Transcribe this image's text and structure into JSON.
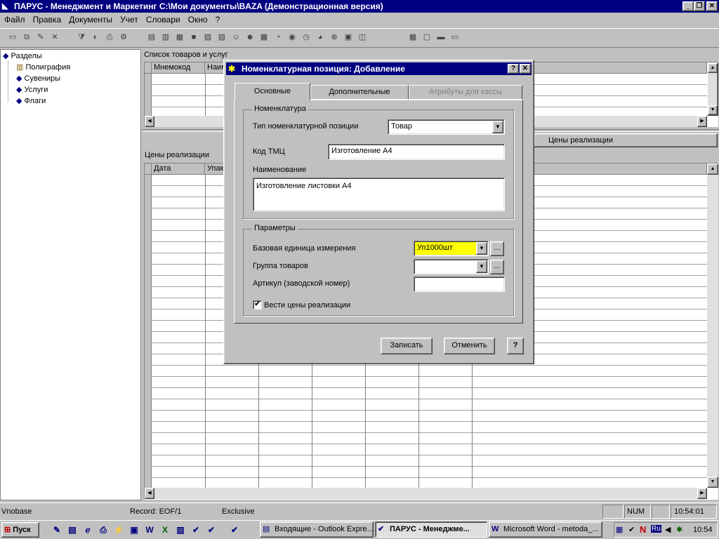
{
  "app": {
    "title": "ПАРУС - Менеджмент и Маркетинг  C:\\Мои документы\\BAZA (Демонстрационная версия)",
    "menu": [
      "Файл",
      "Правка",
      "Документы",
      "Учет",
      "Словари",
      "Окно",
      "?"
    ]
  },
  "tree": {
    "root": "Разделы",
    "items": [
      "Полиграфия",
      "Сувениры",
      "Услуги",
      "Флаги"
    ]
  },
  "goods_panel": {
    "title": "Список товаров и услуг",
    "columns": [
      "Мнемокод",
      "Наим"
    ]
  },
  "prices_tab": "Цены реализации",
  "prices_panel": {
    "title": "Цены реализации",
    "columns": [
      "Дата",
      "Упак"
    ]
  },
  "dialog": {
    "title": "Номенклатурная позиция: Добавление",
    "tabs": [
      "Основные",
      "Дополнительные",
      "Атрибуты для кассы"
    ],
    "group_nomenclature": "Номенклатура",
    "type_label": "Тип номенклатурной позиции",
    "type_value": "Товар",
    "code_label": "Код ТМЦ",
    "code_value": "Изготовление А4",
    "name_label": "Наименование",
    "name_value": "Изготовление листовки А4",
    "group_params": "Параметры",
    "unit_label": "Базовая единица измерения",
    "unit_value": "Уп1000шт",
    "goods_group_label": "Группа товаров",
    "goods_group_value": "",
    "article_label": "Артикул (заводской номер)",
    "article_value": "",
    "track_prices_label": "Вести цены реализации",
    "track_prices_checked": true,
    "save": "Записать",
    "cancel": "Отменить",
    "help": "?",
    "ellipsis": "..."
  },
  "status": {
    "db": "Vnobase",
    "record": "Record: EOF/1",
    "mode": "Exclusive",
    "num": "NUM",
    "time": "10:54:01"
  },
  "taskbar": {
    "start": "Пуск",
    "tasks": [
      "Входящие - Outlook Expre...",
      "ПАРУС - Менеджме...",
      "Microsoft Word - metoda_..."
    ],
    "lang": "Ru",
    "clock": "10:54"
  },
  "colors": {
    "title_bar": "#000080",
    "face": "#c0c0c0",
    "highlight_field": "#ffff00"
  }
}
